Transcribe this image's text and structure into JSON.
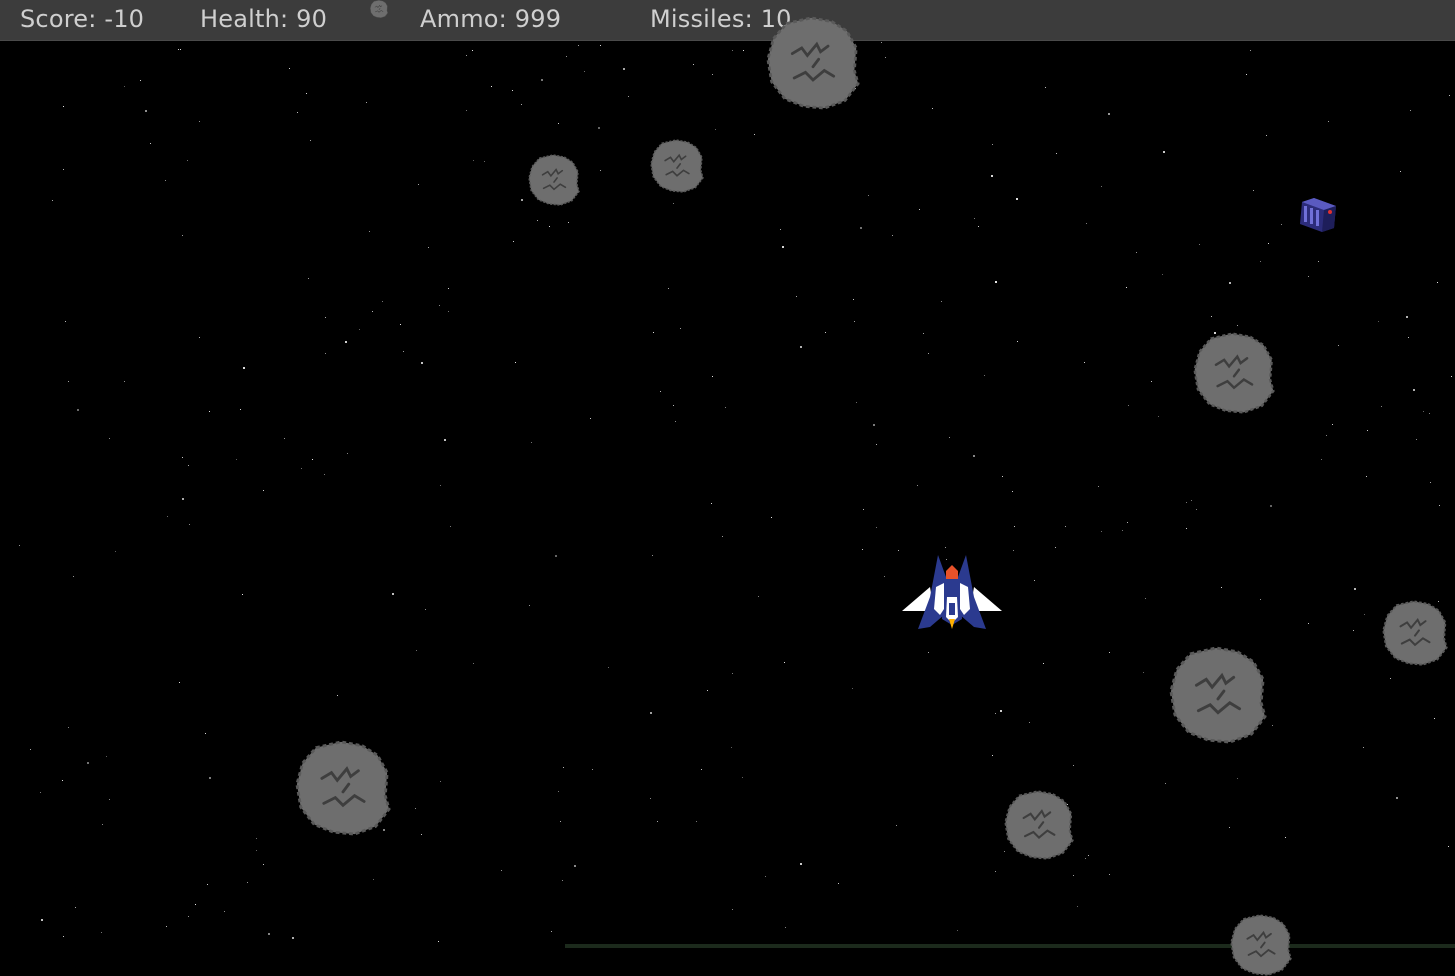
{
  "hud": {
    "score_label": "Score: -10",
    "health_label": "Health: 90",
    "ammo_label": "Ammo: 999",
    "missiles_label": "Missiles: 10"
  },
  "colors": {
    "background": "#000000",
    "hud_bar": "#3c3c3c",
    "hud_text": "#cfcfcf",
    "asteroid": "#6e6e6e",
    "asteroid_crack": "#3e3e3e",
    "ship_body": "#2b3a8f",
    "ship_wing": "#ffffff",
    "ship_cockpit": "#e8522a",
    "ship_flame": "#ffb000",
    "powerup": "#3a3a9a"
  },
  "icons": {
    "player": "player-ship-icon",
    "asteroid": "asteroid-icon",
    "pickup": "ammo-crate-icon"
  }
}
